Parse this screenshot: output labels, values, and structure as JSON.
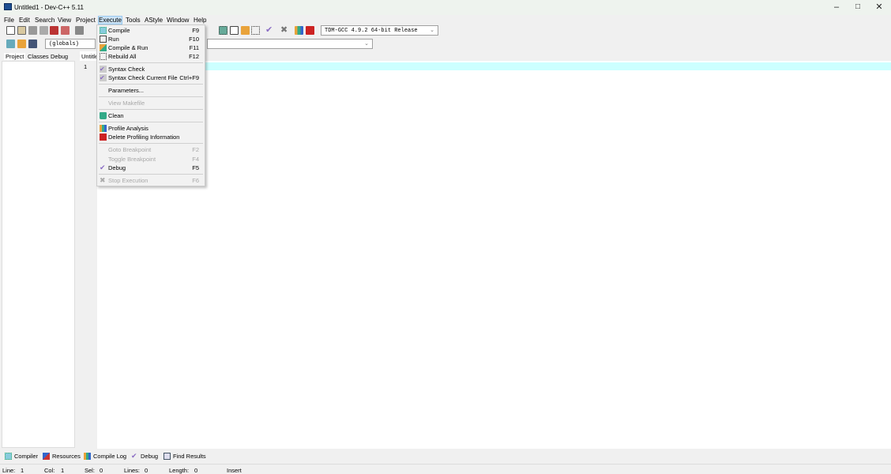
{
  "window": {
    "title": "Untitled1 - Dev-C++ 5.11"
  },
  "menubar": [
    "File",
    "Edit",
    "Search",
    "View",
    "Project",
    "Execute",
    "Tools",
    "AStyle",
    "Window",
    "Help"
  ],
  "toolbar": {
    "compiler_select": "TDM-GCC 4.9.2 64-bit Release",
    "scope_select": "(globals)",
    "symbol_select": ""
  },
  "left_tabs": [
    "Project",
    "Classes",
    "Debug"
  ],
  "editor": {
    "tab": "Untitled1",
    "line_number": "1"
  },
  "execute_menu": [
    {
      "label": "Compile",
      "shortcut": "F9",
      "enabled": true,
      "icon": "compile-icon"
    },
    {
      "label": "Run",
      "shortcut": "F10",
      "enabled": true,
      "icon": "run-icon"
    },
    {
      "label": "Compile & Run",
      "shortcut": "F11",
      "enabled": true,
      "icon": "compile-run-icon"
    },
    {
      "label": "Rebuild All",
      "shortcut": "F12",
      "enabled": true,
      "icon": "rebuild-icon"
    },
    {
      "label": "Syntax Check",
      "shortcut": "",
      "enabled": true,
      "icon": "syntax-check-icon"
    },
    {
      "label": "Syntax Check Current File",
      "shortcut": "Ctrl+F9",
      "enabled": true,
      "icon": "syntax-check-file-icon"
    },
    {
      "label": "Parameters...",
      "shortcut": "",
      "enabled": true,
      "icon": ""
    },
    {
      "label": "View Makefile",
      "shortcut": "",
      "enabled": false,
      "icon": ""
    },
    {
      "label": "Clean",
      "shortcut": "",
      "enabled": true,
      "icon": "trash-icon"
    },
    {
      "label": "Profile Analysis",
      "shortcut": "",
      "enabled": true,
      "icon": "chart-icon"
    },
    {
      "label": "Delete Profiling Information",
      "shortcut": "",
      "enabled": true,
      "icon": "delete-profile-icon"
    },
    {
      "label": "Goto Breakpoint",
      "shortcut": "F2",
      "enabled": false,
      "icon": ""
    },
    {
      "label": "Toggle Breakpoint",
      "shortcut": "F4",
      "enabled": false,
      "icon": ""
    },
    {
      "label": "Debug",
      "shortcut": "F5",
      "enabled": true,
      "icon": "check-icon"
    },
    {
      "label": "Stop Execution",
      "shortcut": "F6",
      "enabled": false,
      "icon": "stop-icon"
    }
  ],
  "bottom_tabs": [
    "Compiler",
    "Resources",
    "Compile Log",
    "Debug",
    "Find Results"
  ],
  "status": {
    "line_label": "Line:",
    "line": "1",
    "col_label": "Col:",
    "col": "1",
    "sel_label": "Sel:",
    "sel": "0",
    "lines_label": "Lines:",
    "lines": "0",
    "length_label": "Length:",
    "length": "0",
    "mode": "Insert"
  },
  "colors": {
    "highlight": "#ccffff",
    "menu_active": "#cce4f7"
  }
}
